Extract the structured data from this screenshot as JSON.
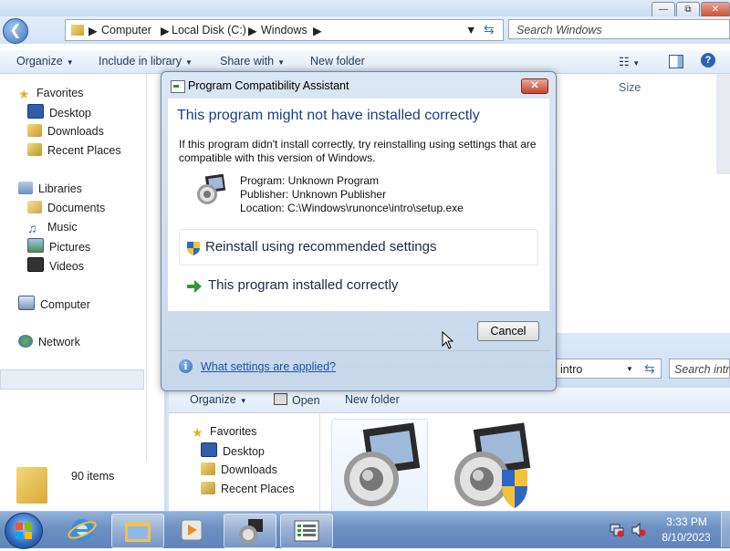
{
  "explorer_back": {
    "breadcrumb": [
      "Computer",
      "Local Disk (C:)",
      "Windows"
    ],
    "search_placeholder": "Search Windows",
    "toolbar": {
      "organize": "Organize",
      "include_in_library": "Include in library",
      "share_with": "Share with",
      "new_folder": "New folder"
    },
    "column_size": "Size",
    "nav": {
      "favorites": "Favorites",
      "desktop": "Desktop",
      "downloads": "Downloads",
      "recent_places": "Recent Places",
      "libraries": "Libraries",
      "documents": "Documents",
      "music": "Music",
      "pictures": "Pictures",
      "videos": "Videos",
      "computer": "Computer",
      "network": "Network"
    },
    "item_count": "90 items"
  },
  "explorer_front": {
    "path": "intro",
    "search_placeholder": "Search intro",
    "toolbar": {
      "organize": "Organize",
      "open": "Open",
      "new_folder": "New folder"
    },
    "nav": {
      "favorites": "Favorites",
      "desktop": "Desktop",
      "downloads": "Downloads",
      "recent_places": "Recent Places"
    }
  },
  "dialog": {
    "title": "Program Compatibility Assistant",
    "heading": "This program might not have installed correctly",
    "description": "If this program didn't install correctly, try reinstalling using settings that are compatible with this version of Windows.",
    "program": "Program: Unknown Program",
    "publisher": "Publisher: Unknown Publisher",
    "location": "Location: C:\\Windows\\runonce\\intro\\setup.exe",
    "option_reinstall": "Reinstall using recommended settings",
    "option_correct": "This program installed correctly",
    "cancel": "Cancel",
    "settings_link": "What settings are applied?"
  },
  "taskbar": {
    "time": "3:33 PM",
    "date": "8/10/2023"
  }
}
